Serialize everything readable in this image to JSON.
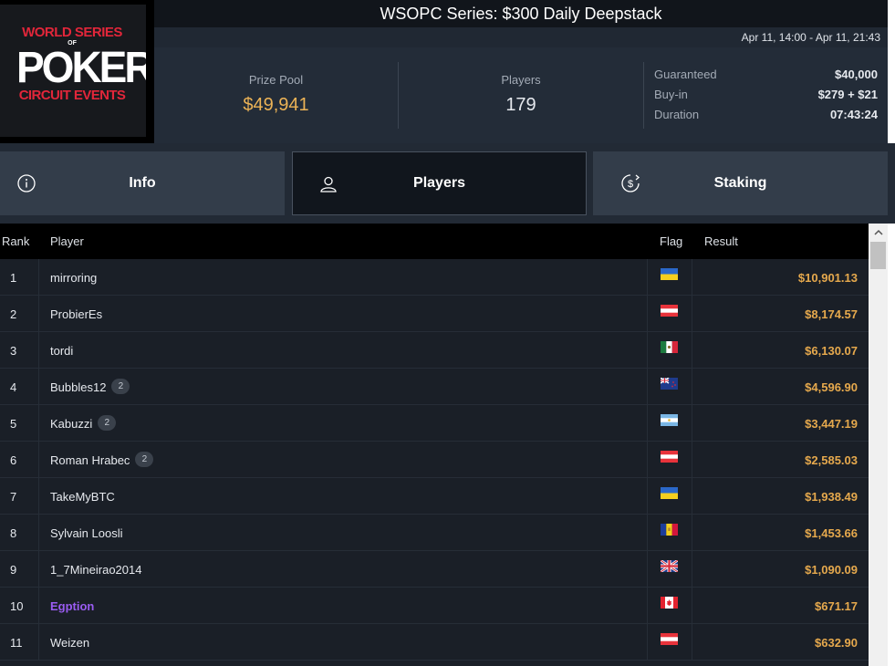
{
  "logo": {
    "line1": "WORLD SERIES",
    "of": "OF",
    "line2": "POKER",
    "line3": "CIRCUIT EVENTS"
  },
  "header": {
    "title": "WSOPC Series: $300 Daily Deepstack",
    "dates": "Apr 11, 14:00 - Apr 11, 21:43"
  },
  "stats": {
    "prize_pool_label": "Prize Pool",
    "prize_pool_value": "$49,941",
    "players_label": "Players",
    "players_value": "179",
    "details": [
      {
        "key": "Guaranteed",
        "value": "$40,000"
      },
      {
        "key": "Buy-in",
        "value": "$279 + $21"
      },
      {
        "key": "Duration",
        "value": "07:43:24"
      }
    ]
  },
  "tabs": [
    {
      "label": "Info",
      "icon": "info-icon"
    },
    {
      "label": "Players",
      "icon": "user-icon",
      "active": true
    },
    {
      "label": "Staking",
      "icon": "dollar-circle-icon"
    }
  ],
  "table": {
    "headers": {
      "rank": "Rank",
      "player": "Player",
      "flag": "Flag",
      "result": "Result"
    },
    "rows": [
      {
        "rank": "1",
        "player": "mirroring",
        "badge": "",
        "flag": "ukraine",
        "result": "$10,901.13"
      },
      {
        "rank": "2",
        "player": "ProbierEs",
        "badge": "",
        "flag": "austria",
        "result": "$8,174.57"
      },
      {
        "rank": "3",
        "player": "tordi",
        "badge": "",
        "flag": "mexico",
        "result": "$6,130.07"
      },
      {
        "rank": "4",
        "player": "Bubbles12",
        "badge": "2",
        "flag": "new-zealand",
        "result": "$4,596.90"
      },
      {
        "rank": "5",
        "player": "Kabuzzi",
        "badge": "2",
        "flag": "argentina",
        "result": "$3,447.19"
      },
      {
        "rank": "6",
        "player": "Roman Hrabec",
        "badge": "2",
        "flag": "austria",
        "result": "$2,585.03"
      },
      {
        "rank": "7",
        "player": "TakeMyBTC",
        "badge": "",
        "flag": "ukraine",
        "result": "$1,938.49"
      },
      {
        "rank": "8",
        "player": "Sylvain Loosli",
        "badge": "",
        "flag": "andorra",
        "result": "$1,453.66"
      },
      {
        "rank": "9",
        "player": "1_7Mineirao2014",
        "badge": "",
        "flag": "united-kingdom",
        "result": "$1,090.09"
      },
      {
        "rank": "10",
        "player": "Egption",
        "badge": "",
        "flag": "canada",
        "result": "$671.17",
        "highlight": true
      },
      {
        "rank": "11",
        "player": "Weizen",
        "badge": "",
        "flag": "austria",
        "result": "$632.90"
      }
    ]
  },
  "colors": {
    "prize": "#ecb356",
    "result": "#e6a94d",
    "highlight_player": "#9a5cf2"
  }
}
